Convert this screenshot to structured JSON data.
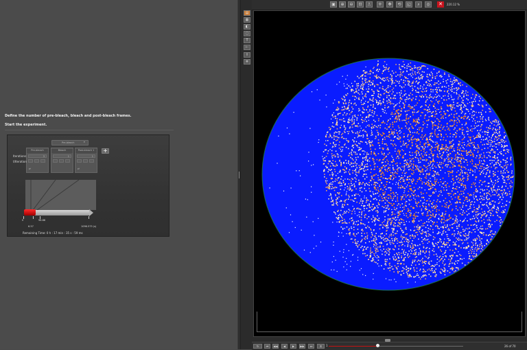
{
  "instructions": {
    "step1": "Define the number of pre-bleach, bleach and post-bleach frames.",
    "step2": "Start the experiment."
  },
  "frap": {
    "dropdown_label": "Pre-bleach",
    "columns": [
      {
        "title": "Pre-bleach",
        "value": "3"
      },
      {
        "title": "Bleach",
        "value": "1"
      },
      {
        "title": "Post-bleach 1",
        "value": "1"
      }
    ],
    "row_iterations": "Iterations",
    "row_t_iteration": "t/Iteration",
    "timeline": {
      "ticks": [
        "0",
        "6.57",
        "98.88",
        "1096.575 (s)"
      ],
      "progress_fraction": 0.22
    },
    "remaining_time": "Remaining Time: 0 h : 17 min : 35 s : 59 ms"
  },
  "viewer": {
    "zoom": "220.12 %",
    "colors": {
      "background": "#000000",
      "mask": "#0a1cff",
      "signal_low": "#ffe9b8",
      "signal_high": "#ff8a10"
    }
  },
  "playback": {
    "start_index": "1",
    "current_frame": "26",
    "of_label": "of",
    "total_frames": "70",
    "progress_fraction": 0.36
  },
  "icons": {
    "toolbar": [
      "snapshot-icon",
      "zoom-in-icon",
      "zoom-out-icon",
      "zoom-fit-icon",
      "ruler-icon",
      "crosshair-icon",
      "move-icon",
      "rotate-icon",
      "zoom-region-icon",
      "zoom-reset-icon",
      "zoom-100-icon"
    ],
    "side": [
      "display-icon",
      "overlay-icon",
      "channel-icon",
      "roi-icon",
      "text-icon",
      "scalebar-icon",
      "export-icon",
      "stack-icon"
    ],
    "playback": [
      "loop-icon",
      "first-frame-icon",
      "step-back-icon",
      "play-reverse-icon",
      "play-icon",
      "step-forward-icon",
      "last-frame-icon",
      "fps-icon"
    ]
  }
}
